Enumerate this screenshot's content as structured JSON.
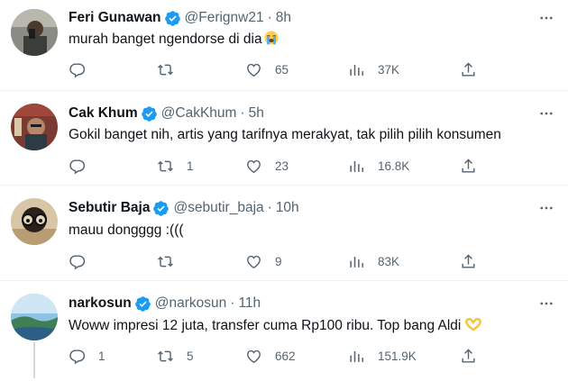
{
  "colors": {
    "text": "#0f1419",
    "muted": "#536471",
    "verified": "#1d9bf0",
    "divider": "#eff3f4"
  },
  "tweets": [
    {
      "name": "Feri Gunawan",
      "handle": "@Ferignw21",
      "time": "8h",
      "text": "murah banget ngendorse di dia",
      "emoji": "crying-face",
      "reply_count": "",
      "retweet_count": "",
      "like_count": "65",
      "view_count": "37K"
    },
    {
      "name": "Cak Khum",
      "handle": "@CakKhum",
      "time": "5h",
      "text": "Gokil banget nih, artis yang tarifnya merakyat, tak pilih pilih konsumen",
      "emoji": "",
      "reply_count": "",
      "retweet_count": "1",
      "like_count": "23",
      "view_count": "16.8K"
    },
    {
      "name": "Sebutir Baja",
      "handle": "@sebutir_baja",
      "time": "10h",
      "text": "mauu dongggg :(((",
      "emoji": "",
      "reply_count": "",
      "retweet_count": "",
      "like_count": "9",
      "view_count": "83K"
    },
    {
      "name": "narkosun",
      "handle": "@narkosun",
      "time": "11h",
      "text": "Woww impresi 12 juta, transfer cuma Rp100 ribu. Top bang Aldi",
      "emoji": "heart-hands",
      "reply_count": "1",
      "retweet_count": "5",
      "like_count": "662",
      "view_count": "151.9K"
    }
  ]
}
